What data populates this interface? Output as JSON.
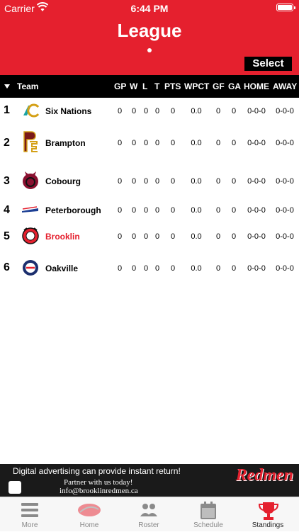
{
  "status_bar": {
    "carrier": "Carrier",
    "time": "6:44 PM"
  },
  "header": {
    "title": "League",
    "select_label": "Select"
  },
  "table": {
    "columns": [
      "Team",
      "GP",
      "W",
      "L",
      "T",
      "PTS",
      "WPCT",
      "GF",
      "GA",
      "HOME",
      "AWAY"
    ],
    "rows": [
      {
        "rank": "1",
        "team": "Six Nations",
        "gp": "0",
        "w": "0",
        "l": "0",
        "t": "0",
        "pts": "0",
        "wpct": "0.0",
        "gf": "0",
        "ga": "0",
        "home": "0-0-0",
        "away": "0-0-0"
      },
      {
        "rank": "2",
        "team": "Brampton",
        "gp": "0",
        "w": "0",
        "l": "0",
        "t": "0",
        "pts": "0",
        "wpct": "0.0",
        "gf": "0",
        "ga": "0",
        "home": "0-0-0",
        "away": "0-0-0"
      },
      {
        "rank": "3",
        "team": "Cobourg",
        "gp": "0",
        "w": "0",
        "l": "0",
        "t": "0",
        "pts": "0",
        "wpct": "0.0",
        "gf": "0",
        "ga": "0",
        "home": "0-0-0",
        "away": "0-0-0"
      },
      {
        "rank": "4",
        "team": "Peterborough",
        "gp": "0",
        "w": "0",
        "l": "0",
        "t": "0",
        "pts": "0",
        "wpct": "0.0",
        "gf": "0",
        "ga": "0",
        "home": "0-0-0",
        "away": "0-0-0"
      },
      {
        "rank": "5",
        "team": "Brooklin",
        "gp": "0",
        "w": "0",
        "l": "0",
        "t": "0",
        "pts": "0",
        "wpct": "0.0",
        "gf": "0",
        "ga": "0",
        "home": "0-0-0",
        "away": "0-0-0"
      },
      {
        "rank": "6",
        "team": "Oakville",
        "gp": "0",
        "w": "0",
        "l": "0",
        "t": "0",
        "pts": "0",
        "wpct": "0.0",
        "gf": "0",
        "ga": "0",
        "home": "0-0-0",
        "away": "0-0-0"
      }
    ]
  },
  "ad": {
    "line1": "Digital advertising can provide instant return!",
    "line2": "Partner with us today!",
    "line3": "info@brooklinredmen.ca",
    "brand": "Redmen"
  },
  "tabs": [
    {
      "label": "More",
      "icon": "menu-icon"
    },
    {
      "label": "Home",
      "icon": "team-logo-icon"
    },
    {
      "label": "Roster",
      "icon": "people-icon"
    },
    {
      "label": "Schedule",
      "icon": "calendar-icon"
    },
    {
      "label": "Standings",
      "icon": "trophy-icon"
    }
  ],
  "colors": {
    "brand_red": "#e5202e",
    "header_black": "#000000"
  }
}
